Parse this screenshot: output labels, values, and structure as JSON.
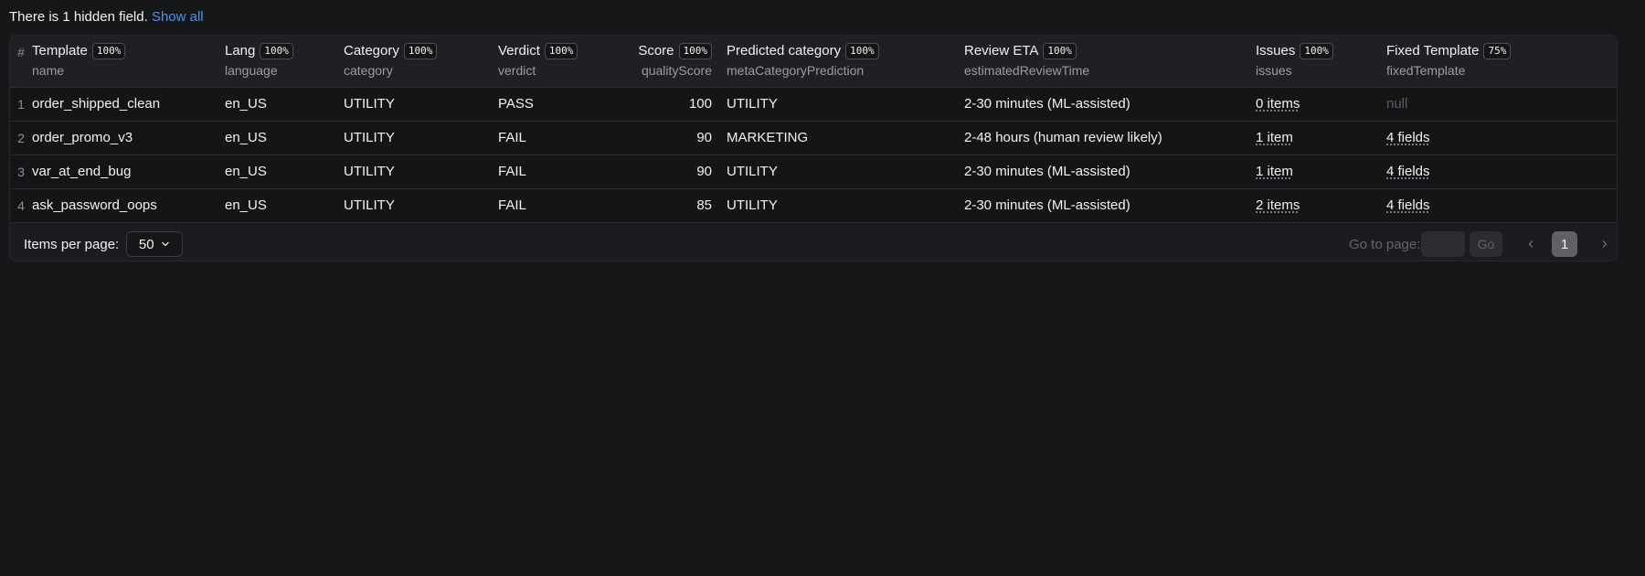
{
  "banner": {
    "text": "There is 1 hidden field.",
    "link": "Show all"
  },
  "table": {
    "index_header": "#",
    "columns": [
      {
        "title": "Template",
        "pct": "100%",
        "field": "name"
      },
      {
        "title": "Lang",
        "pct": "100%",
        "field": "language"
      },
      {
        "title": "Category",
        "pct": "100%",
        "field": "category"
      },
      {
        "title": "Verdict",
        "pct": "100%",
        "field": "verdict"
      },
      {
        "title": "Score",
        "pct": "100%",
        "field": "qualityScore"
      },
      {
        "title": "Predicted category",
        "pct": "100%",
        "field": "metaCategoryPrediction"
      },
      {
        "title": "Review ETA",
        "pct": "100%",
        "field": "estimatedReviewTime"
      },
      {
        "title": "Issues",
        "pct": "100%",
        "field": "issues"
      },
      {
        "title": "Fixed Template",
        "pct": "75%",
        "field": "fixedTemplate"
      }
    ],
    "rows": [
      {
        "index": "1",
        "name": "order_shipped_clean",
        "language": "en_US",
        "category": "UTILITY",
        "verdict": "PASS",
        "score": "100",
        "predicted": "UTILITY",
        "eta": "2-30 minutes (ML-assisted)",
        "issues": "0 items",
        "fixed": "null"
      },
      {
        "index": "2",
        "name": "order_promo_v3",
        "language": "en_US",
        "category": "UTILITY",
        "verdict": "FAIL",
        "score": "90",
        "predicted": "MARKETING",
        "eta": "2-48 hours (human review likely)",
        "issues": "1 item",
        "fixed": "4 fields"
      },
      {
        "index": "3",
        "name": "var_at_end_bug",
        "language": "en_US",
        "category": "UTILITY",
        "verdict": "FAIL",
        "score": "90",
        "predicted": "UTILITY",
        "eta": "2-30 minutes (ML-assisted)",
        "issues": "1 item",
        "fixed": "4 fields"
      },
      {
        "index": "4",
        "name": "ask_password_oops",
        "language": "en_US",
        "category": "UTILITY",
        "verdict": "FAIL",
        "score": "85",
        "predicted": "UTILITY",
        "eta": "2-30 minutes (ML-assisted)",
        "issues": "2 items",
        "fixed": "4 fields"
      }
    ]
  },
  "pagination": {
    "items_per_page_label": "Items per page:",
    "items_per_page_value": "50",
    "goto_label": "Go to page:",
    "go_button": "Go",
    "current_page": "1"
  }
}
